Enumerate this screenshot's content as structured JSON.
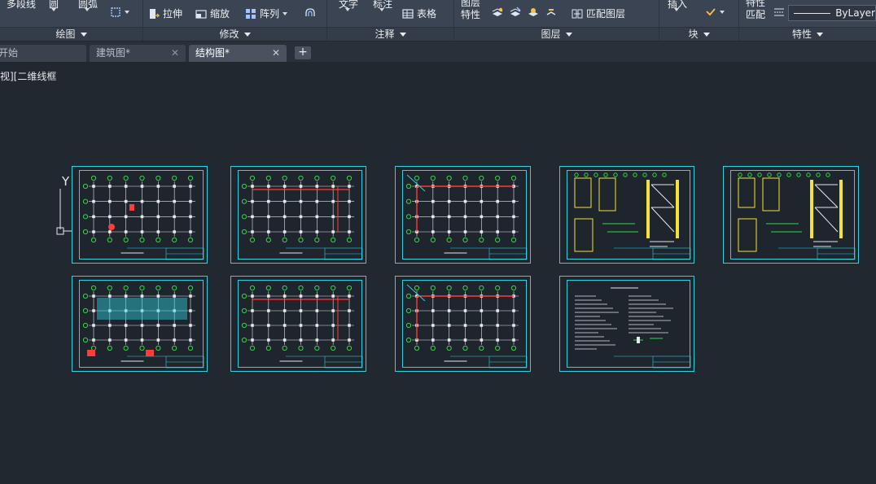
{
  "ribbon": {
    "draw": {
      "polyline": "多段线",
      "circle": "圆",
      "arc": "圆弧",
      "title": "绘图"
    },
    "modify": {
      "stretch": "拉伸",
      "scale": "缩放",
      "array": "阵列",
      "title": "修改"
    },
    "annotation": {
      "text": "文字",
      "dimension": "标注",
      "table": "表格",
      "title": "注释"
    },
    "layers": {
      "layer_props_line1": "图层",
      "layer_props_line2": "特性",
      "match_layer": "匹配图层",
      "title": "图层"
    },
    "block": {
      "insert": "插入",
      "title": "块"
    },
    "properties": {
      "match_line1": "特性",
      "match_line2": "匹配",
      "bylayer": "ByLayer",
      "title": "特性"
    }
  },
  "tabs": [
    {
      "label": "开始"
    },
    {
      "label": "建筑图*"
    },
    {
      "label": "结构图*"
    }
  ],
  "tab_add": "+",
  "viewport_label": "视][二维线框",
  "ucs": {
    "y_label": "Y"
  },
  "colors": {
    "accent": "#2fd0e0",
    "background": "#212830",
    "ribbon": "#3b4453"
  }
}
